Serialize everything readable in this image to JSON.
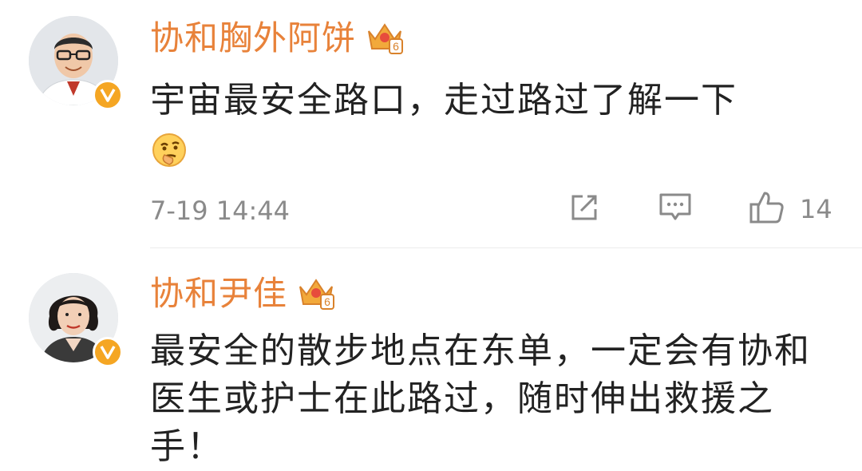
{
  "comments": [
    {
      "name": "协和胸外阿饼",
      "badge": "crown-level-6-icon",
      "verified": "verified-v-icon",
      "text": "宇宙最安全路口，走过路过了解一下",
      "emoji": "thinking-face-icon",
      "time": "7-19 14:44",
      "actions": {
        "share": "share-icon",
        "comment": "comment-icon",
        "like": "thumbs-up-icon"
      },
      "like_count": "14"
    },
    {
      "name": "协和尹佳",
      "badge": "crown-level-6-icon",
      "verified": "verified-v-icon",
      "text": "最安全的散步地点在东单，一定会有协和医生或护士在此路过，随时伸出救援之手！"
    }
  ],
  "colors": {
    "name": "#e8823a",
    "text": "#222222",
    "meta": "#8a8a8a",
    "verified": "#f5a623"
  }
}
